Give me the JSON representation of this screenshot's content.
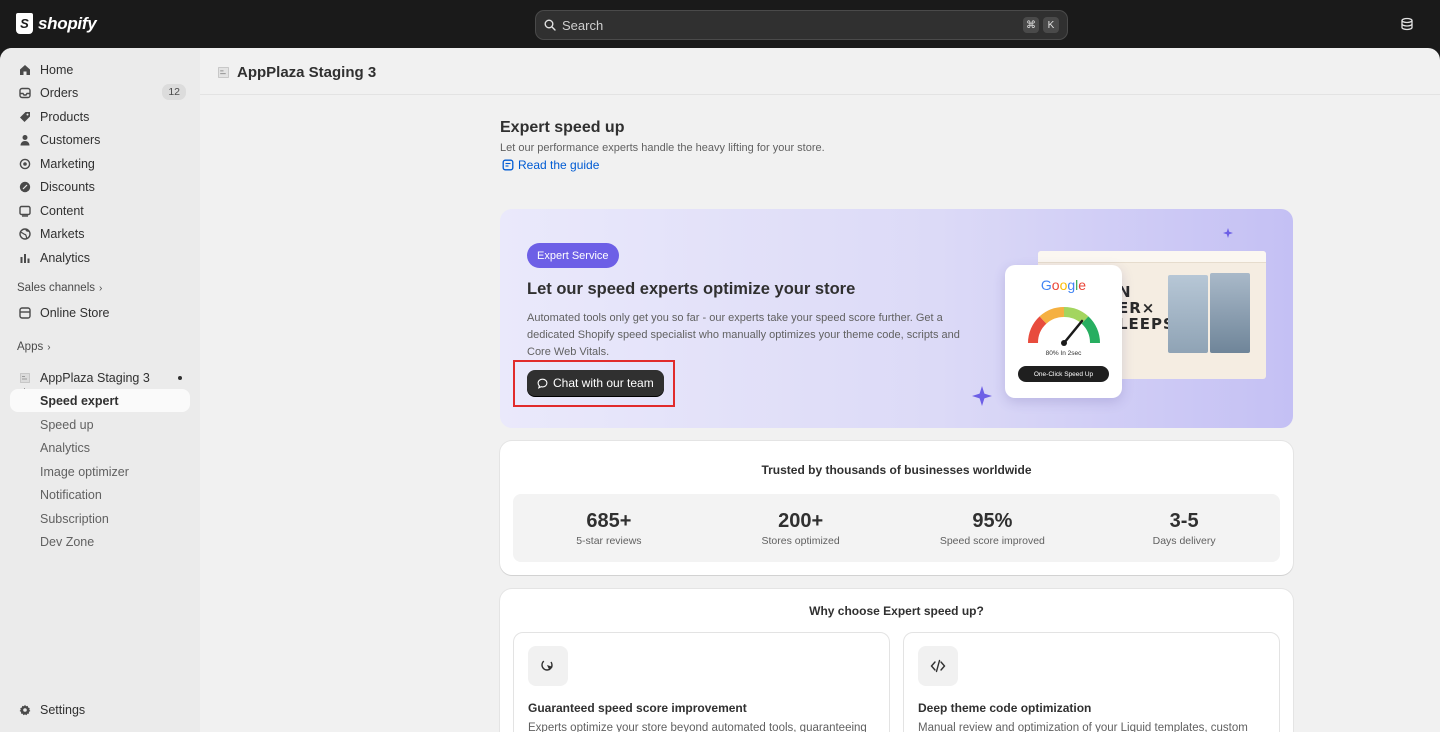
{
  "topbar": {
    "brand": "shopify",
    "search_placeholder": "Search",
    "shortcut_keys": [
      "⌘",
      "K"
    ]
  },
  "sidebar": {
    "items": [
      {
        "label": "Home",
        "icon": "home-icon"
      },
      {
        "label": "Orders",
        "icon": "orders-icon",
        "badge": "12"
      },
      {
        "label": "Products",
        "icon": "tag-icon"
      },
      {
        "label": "Customers",
        "icon": "person-icon"
      },
      {
        "label": "Marketing",
        "icon": "target-icon"
      },
      {
        "label": "Discounts",
        "icon": "discount-icon"
      },
      {
        "label": "Content",
        "icon": "content-icon"
      },
      {
        "label": "Markets",
        "icon": "globe-icon"
      },
      {
        "label": "Analytics",
        "icon": "bar-chart-icon"
      }
    ],
    "sales_channels_label": "Sales channels",
    "online_store_label": "Online Store",
    "apps_label": "Apps",
    "app_name": "AppPlaza Staging 3",
    "app_sub_items": [
      "Speed expert",
      "Speed up",
      "Analytics",
      "Image optimizer",
      "Notification",
      "Subscription",
      "Dev Zone"
    ],
    "settings_label": "Settings"
  },
  "page": {
    "title": "AppPlaza Staging 3",
    "intro_title": "Expert speed up",
    "intro_subtitle": "Let our performance experts handle the heavy lifting for your store.",
    "guide_link": "Read the guide"
  },
  "hero": {
    "pill": "Expert Service",
    "title": "Let our speed experts optimize your store",
    "description": "Automated tools only get you so far - our experts take your speed score further. Get a dedicated Shopify speed specialist who manually optimizes your theme code, scripts and Core Web Vitals.",
    "cta": "Chat with our team",
    "google_label": "Google",
    "gauge_caption": "80% In 2sec",
    "gauge_button": "One-Click Speed Up",
    "accent": "#6d5fe6",
    "highlight_color": "#e12b2b"
  },
  "stats": {
    "title": "Trusted by thousands of businesses worldwide",
    "items": [
      {
        "value": "685+",
        "label": "5-star reviews"
      },
      {
        "value": "200+",
        "label": "Stores optimized"
      },
      {
        "value": "95%",
        "label": "Speed score improved"
      },
      {
        "value": "3-5",
        "label": "Days delivery"
      }
    ]
  },
  "why": {
    "title": "Why choose Expert speed up?",
    "features": [
      {
        "title": "Guaranteed speed score improvement",
        "description": "Experts optimize your store beyond automated tools, guaranteeing",
        "icon": "cursor-click-icon"
      },
      {
        "title": "Deep theme code optimization",
        "description": "Manual review and optimization of your Liquid templates, custom",
        "icon": "code-icon"
      }
    ]
  }
}
